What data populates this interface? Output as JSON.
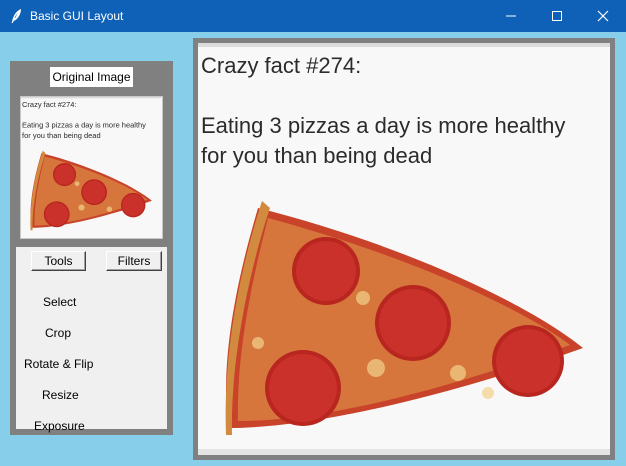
{
  "window": {
    "title": "Basic GUI Layout",
    "icon": "feather-icon",
    "controls": [
      "minimize-icon",
      "maximize-icon",
      "close-icon"
    ]
  },
  "left_panel": {
    "label": "Original Image",
    "thumbnail": {
      "heading": "Crazy fact #274:",
      "line1": "Eating 3 pizzas a day is more healthy",
      "line2": "for you than being dead"
    }
  },
  "tools_panel": {
    "tools_button": "Tools",
    "filters_button": "Filters",
    "items": [
      "Select",
      "Crop",
      "Rotate & Flip",
      "Resize",
      "Exposure"
    ]
  },
  "main_image": {
    "heading": "Crazy fact #274:",
    "line1": "Eating 3 pizzas a day is more healthy",
    "line2": "for you than being dead"
  },
  "colors": {
    "titlebar": "#0f61b8",
    "background": "#87ceeb",
    "panel": "#808080",
    "tools_panel": "#f0f0f0"
  }
}
